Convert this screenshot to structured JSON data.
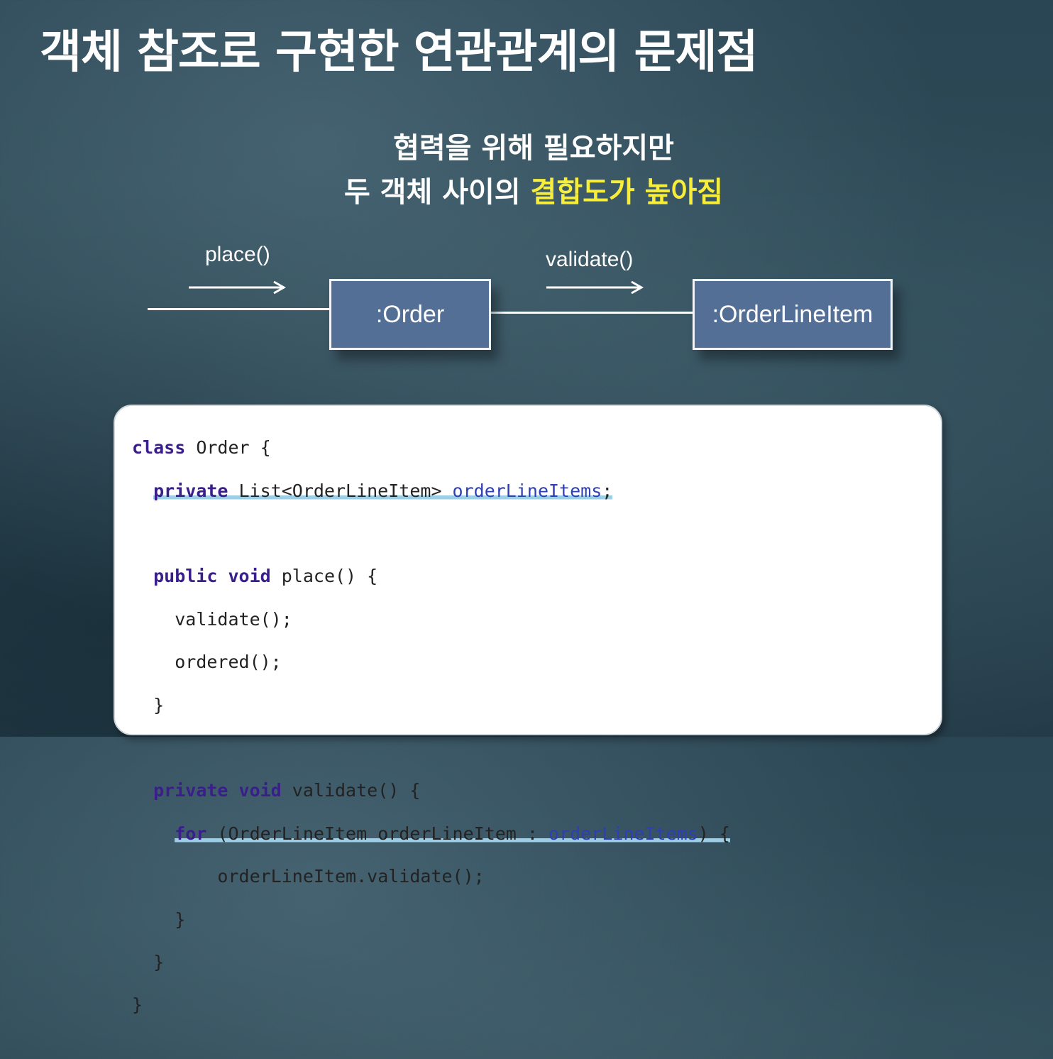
{
  "title": "객체 참조로 구현한 연관관계의 문제점",
  "subtitle": {
    "line1": "협력을 위해 필요하지만",
    "line2_prefix": "두 객체 사이의 ",
    "line2_highlight": "결합도가 높아짐"
  },
  "diagram": {
    "message_place": "place()",
    "message_validate": "validate()",
    "box_order": ":Order",
    "box_orderlineitem": ":OrderLineItem"
  },
  "code": {
    "l1_kw": "class",
    "l1_rest": " Order {",
    "l2_kw": "private",
    "l2_type": " List<OrderLineItem> ",
    "l2_field": "orderLineItems",
    "l2_end": ";",
    "l4_kw1": "public",
    "l4_kw2": "void",
    "l4_rest": " place() {",
    "l5": "validate();",
    "l6": "ordered();",
    "l7": "}",
    "l9_kw1": "private",
    "l9_kw2": "void",
    "l9_rest": " validate() {",
    "l10_kw": "for",
    "l10_mid": " (OrderLineItem orderLineItem : ",
    "l10_field": "orderLineItems",
    "l10_end": ") {",
    "l11": "orderLineItem.validate();",
    "l12": "}",
    "l13": "}",
    "l14": "}"
  },
  "colors": {
    "highlight": "#f6ee3a",
    "box_fill": "#546f96",
    "keyword": "#3a1f8c",
    "field": "#2e3fb3",
    "underline": "#9ccfe6"
  }
}
